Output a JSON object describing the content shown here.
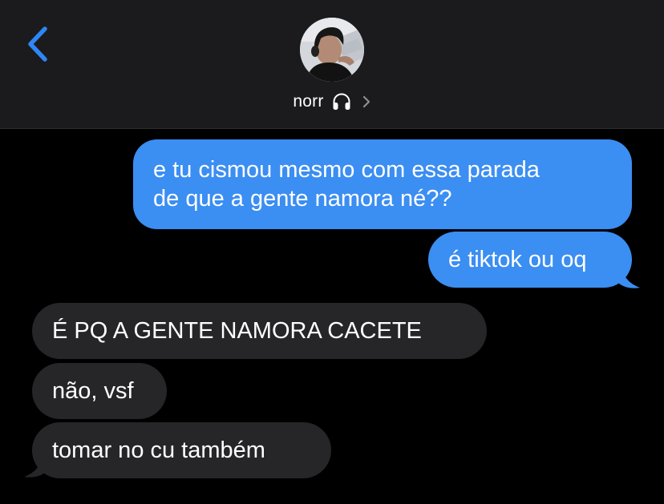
{
  "header": {
    "contact_name": "norr",
    "back_icon": "chevron-left-icon",
    "status_icon": "headphones-icon",
    "disclosure_icon": "chevron-right-icon"
  },
  "colors": {
    "sent_bubble": "#3b8ef2",
    "received_bubble": "#262629",
    "accent": "#2f86f6",
    "header_bg": "#1b1b1d"
  },
  "messages": [
    {
      "direction": "sent",
      "lines": [
        "e tu cismou mesmo com essa parada",
        "de que a gente namora né??"
      ]
    },
    {
      "direction": "sent",
      "text": "é tiktok ou oq"
    },
    {
      "direction": "received",
      "text": "É PQ A GENTE NAMORA CACETE"
    },
    {
      "direction": "received",
      "text": "não, vsf"
    },
    {
      "direction": "received",
      "text": "tomar no cu também"
    }
  ]
}
